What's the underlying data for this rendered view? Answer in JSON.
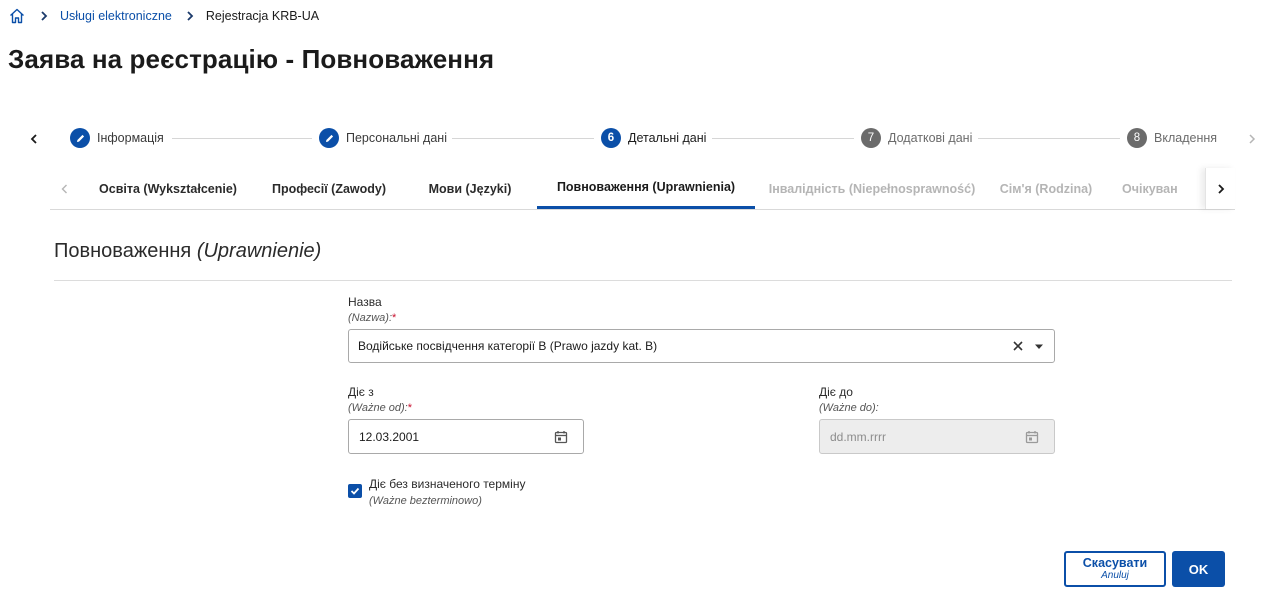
{
  "breadcrumb": {
    "home_icon": "home-icon",
    "items": [
      {
        "label": "Usługi elektroniczne",
        "link": true
      },
      {
        "label": "Rejestracja KRB-UA",
        "link": false
      }
    ]
  },
  "page_title": "Заява на реєстрацію - Повноваження",
  "stepper": {
    "steps": [
      {
        "number": "",
        "label": "Інформація",
        "state": "done",
        "icon": "pencil-icon"
      },
      {
        "number": "",
        "label": "Персональні дані",
        "state": "done",
        "icon": "pencil-icon"
      },
      {
        "number": "6",
        "label": "Детальні дані",
        "state": "active"
      },
      {
        "number": "7",
        "label": "Додаткові дані",
        "state": "todo"
      },
      {
        "number": "8",
        "label": "Вкладення",
        "state": "todo"
      }
    ]
  },
  "tabs": [
    {
      "label": "Освіта (Wykształcenie)",
      "state": "normal"
    },
    {
      "label": "Професії (Zawody)",
      "state": "normal"
    },
    {
      "label": "Мови (Języki)",
      "state": "normal"
    },
    {
      "label": "Повноваження (Uprawnienia)",
      "state": "active"
    },
    {
      "label": "Інвалідність (Niepełnosprawność)",
      "state": "disabled"
    },
    {
      "label": "Сім'я (Rodzina)",
      "state": "disabled"
    },
    {
      "label": "Очікуван",
      "state": "disabled"
    }
  ],
  "section": {
    "title": "Повноваження",
    "title_pl": "(Uprawnienie)"
  },
  "form": {
    "name": {
      "label": "Назва",
      "sub": "(Nazwa):",
      "required": "*",
      "value": "Водійське посвідчення категорії B (Prawo jazdy kat. B)"
    },
    "valid_from": {
      "label": "Діє з",
      "sub": "(Ważne od):",
      "required": "*",
      "value": "12.03.2001"
    },
    "valid_to": {
      "label": "Діє до",
      "sub": "(Ważne do):",
      "placeholder": "dd.mm.rrrr",
      "disabled": true
    },
    "indefinite": {
      "checked": true,
      "label": "Діє без визначеного терміну",
      "sub": "(Ważne bezterminowo)"
    }
  },
  "actions": {
    "cancel_label": "Скасувати",
    "cancel_sub": "Anuluj",
    "ok_label": "OK"
  },
  "colors": {
    "accent": "#0b4fa8",
    "required": "#c8102e",
    "disabled_text": "#b5b5b5"
  }
}
